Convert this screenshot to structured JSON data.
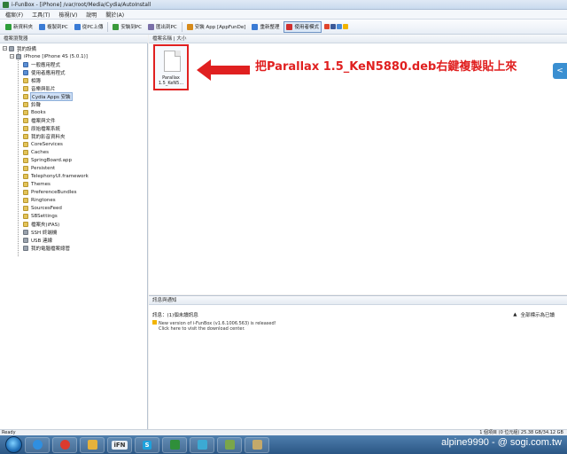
{
  "window": {
    "title": "i-FunBox - [iPhone] /var/root/Media/Cydia/AutoInstall"
  },
  "menu": [
    "檔案(F)",
    "工具(T)",
    "檢視(V)",
    "說明",
    "關於(A)"
  ],
  "toolbar": {
    "buttons": [
      {
        "label": "新資料夾",
        "color": "#2e9e3a"
      },
      {
        "label": "複製到PC",
        "color": "#3a7bd5"
      },
      {
        "label": "從PC上傳",
        "color": "#3a7bd5"
      },
      {
        "label": "安裝到PC",
        "color": "#3a9a3a"
      },
      {
        "label": "匯出到PC",
        "color": "#7a6fa8"
      },
      {
        "label": "安裝 App [AppFunDe]",
        "color": "#d68a1a"
      },
      {
        "label": "重新整理",
        "color": "#3a7bd5"
      },
      {
        "label": "使用者模式",
        "color": "#cf3030",
        "active": true
      }
    ],
    "social_colors": [
      "#e0452b",
      "#3b5998",
      "#4a8ad6",
      "#f0b400"
    ]
  },
  "left_pane": {
    "header": "檔案瀏覽器",
    "tree": [
      {
        "label": "我的設備",
        "depth": 0,
        "icon": "dev",
        "twisty": "-"
      },
      {
        "label": "iPhone [iPhone 4S (5.0.1)]",
        "depth": 1,
        "icon": "dev",
        "twisty": "-"
      },
      {
        "label": "一般應用程式",
        "depth": 2,
        "icon": "app"
      },
      {
        "label": "使用者應用程式",
        "depth": 2,
        "icon": "app"
      },
      {
        "label": "相簿",
        "depth": 2,
        "icon": "folder"
      },
      {
        "label": "音樂與影片",
        "depth": 2,
        "icon": "folder"
      },
      {
        "label": "Cydia Apps 安裝",
        "depth": 2,
        "icon": "folder",
        "selected": true
      },
      {
        "label": "鈴聲",
        "depth": 2,
        "icon": "folder"
      },
      {
        "label": "Books",
        "depth": 2,
        "icon": "folder"
      },
      {
        "label": "檔案與文件",
        "depth": 2,
        "icon": "folder"
      },
      {
        "label": "原始檔案系統",
        "depth": 2,
        "icon": "folder"
      },
      {
        "label": "我的影音資料夾",
        "depth": 2,
        "icon": "folder"
      },
      {
        "label": "CoreServices",
        "depth": 2,
        "icon": "folder"
      },
      {
        "label": "Caches",
        "depth": 2,
        "icon": "folder"
      },
      {
        "label": "SpringBoard.app",
        "depth": 2,
        "icon": "folder"
      },
      {
        "label": "Persistent",
        "depth": 2,
        "icon": "folder"
      },
      {
        "label": "TelephonyUI.framework",
        "depth": 2,
        "icon": "folder"
      },
      {
        "label": "Themes",
        "depth": 2,
        "icon": "folder"
      },
      {
        "label": "PreferenceBundles",
        "depth": 2,
        "icon": "folder"
      },
      {
        "label": "Ringtones",
        "depth": 2,
        "icon": "folder"
      },
      {
        "label": "SourcesFeed",
        "depth": 2,
        "icon": "folder"
      },
      {
        "label": "SBSettings",
        "depth": 2,
        "icon": "folder"
      },
      {
        "label": "檔案夾(iFAS)",
        "depth": 2,
        "icon": "folder"
      },
      {
        "label": "SSH 終端機",
        "depth": 2,
        "icon": "dev"
      },
      {
        "label": "USB 連線",
        "depth": 2,
        "icon": "dev"
      },
      {
        "label": "我的電腦檔案總管",
        "depth": 2,
        "icon": "dev"
      }
    ]
  },
  "right_pane": {
    "header": "檔案名稱 | 大小",
    "file": {
      "name_line1": "Parallax",
      "name_line2": "1.5_KeN5..."
    },
    "annotation": "把Parallax 1.5_KeN5880.deb右鍵複製貼上來",
    "side_tab_glyph": "<"
  },
  "log_pane": {
    "header": "訊息與通知",
    "bar_label": "訊息：(1)個未讀訊息",
    "bar_right": "全部標示為已讀",
    "lines": [
      "New version of i-FunBox (v1.6.1006.563) is released!",
      "Click here to visit the download center."
    ]
  },
  "statusbar": {
    "left": "Ready",
    "right": "1 個項目 (0 位元組)  25.38 GB/34.12 GB"
  },
  "taskbar": {
    "items": [
      {
        "icon": "ie-icon",
        "color": "#2f8fe0"
      },
      {
        "icon": "chrome-icon",
        "color": "#dc3b2e"
      },
      {
        "icon": "explorer-icon",
        "color": "#e5b23c"
      },
      {
        "icon": "app-icon",
        "color": "#e9eef4",
        "text": "iFN"
      },
      {
        "icon": "skype-icon",
        "color": "#1da1dc",
        "text": "S"
      },
      {
        "icon": "ifunbox-icon",
        "color": "#2f8f3a"
      },
      {
        "icon": "paint-icon",
        "color": "#3ca9d3"
      },
      {
        "icon": "tool-icon",
        "color": "#7aa64a"
      },
      {
        "icon": "settings-icon",
        "color": "#c4a96a"
      }
    ],
    "watermark": "alpine9990 - @ sogi.com.tw"
  }
}
